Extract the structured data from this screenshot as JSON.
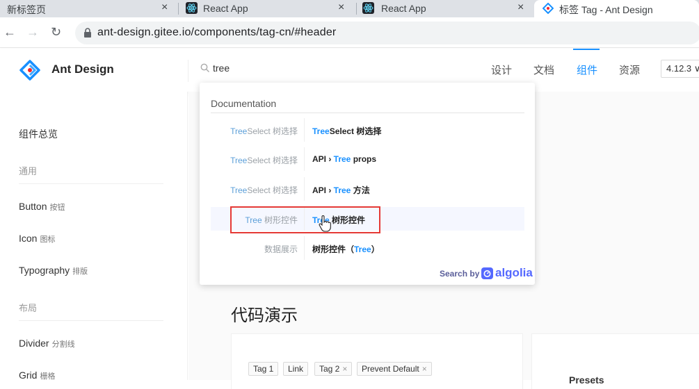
{
  "browser": {
    "tabs": [
      {
        "title": "新标签页",
        "close": "×"
      },
      {
        "title": "React App",
        "close": "×"
      },
      {
        "title": "React App",
        "close": "×"
      },
      {
        "title": "标签 Tag - Ant Design",
        "close": "×"
      }
    ],
    "url": "ant-design.gitee.io/components/tag-cn/#header",
    "nav": {
      "back": "←",
      "forward": "→",
      "reload": "↻"
    }
  },
  "header": {
    "brand": "Ant Design",
    "search": {
      "value": "tree"
    },
    "nav": [
      "设计",
      "文档",
      "组件",
      "资源"
    ],
    "active_nav": "组件",
    "version": "4.12.3 ∨"
  },
  "sidebar": {
    "overview": "组件总览",
    "groups": [
      "通用",
      "布局"
    ],
    "items": [
      {
        "label": "Button",
        "sub": "按钮"
      },
      {
        "label": "Icon",
        "sub": "图标"
      },
      {
        "label": "Typography",
        "sub": "排版"
      },
      {
        "label": "Divider",
        "sub": "分割线"
      },
      {
        "label": "Grid",
        "sub": "栅格"
      }
    ]
  },
  "main": {
    "section_title": "代码演示",
    "tags": [
      {
        "label": "Tag 1",
        "closable": false
      },
      {
        "label": "Link",
        "closable": false
      },
      {
        "label": "Tag 2",
        "closable": true,
        "close": "×"
      },
      {
        "label": "Prevent Default",
        "closable": true,
        "close": "×"
      }
    ],
    "presets": "Presets"
  },
  "dropdown": {
    "category": "Documentation",
    "rows": [
      {
        "left_hl": "Tree",
        "left_rest": "Select 树选择",
        "right_hl": "Tree",
        "right_pre": "",
        "right_rest": "Select 树选择"
      },
      {
        "left_hl": "Tree",
        "left_rest": "Select 树选择",
        "right_pre": "API › ",
        "right_hl": "Tree",
        "right_rest": " props"
      },
      {
        "left_hl": "Tree",
        "left_rest": "Select 树选择",
        "right_pre": "API › ",
        "right_hl": "Tree",
        "right_rest": " 方法"
      },
      {
        "left_hl": "Tree",
        "left_rest": " 树形控件",
        "right_pre": "",
        "right_hl": "Tree",
        "right_rest": " 树形控件"
      },
      {
        "left_hl": "",
        "left_rest": "数据展示",
        "right_pre": "树形控件（",
        "right_hl": "Tree",
        "right_rest": "）"
      }
    ],
    "footer": {
      "search_by": "Search by",
      "brand": "algolia"
    }
  },
  "colors": {
    "primary": "#1890ff",
    "highlight_box": "#e53935",
    "algolia": "#5468ff"
  }
}
